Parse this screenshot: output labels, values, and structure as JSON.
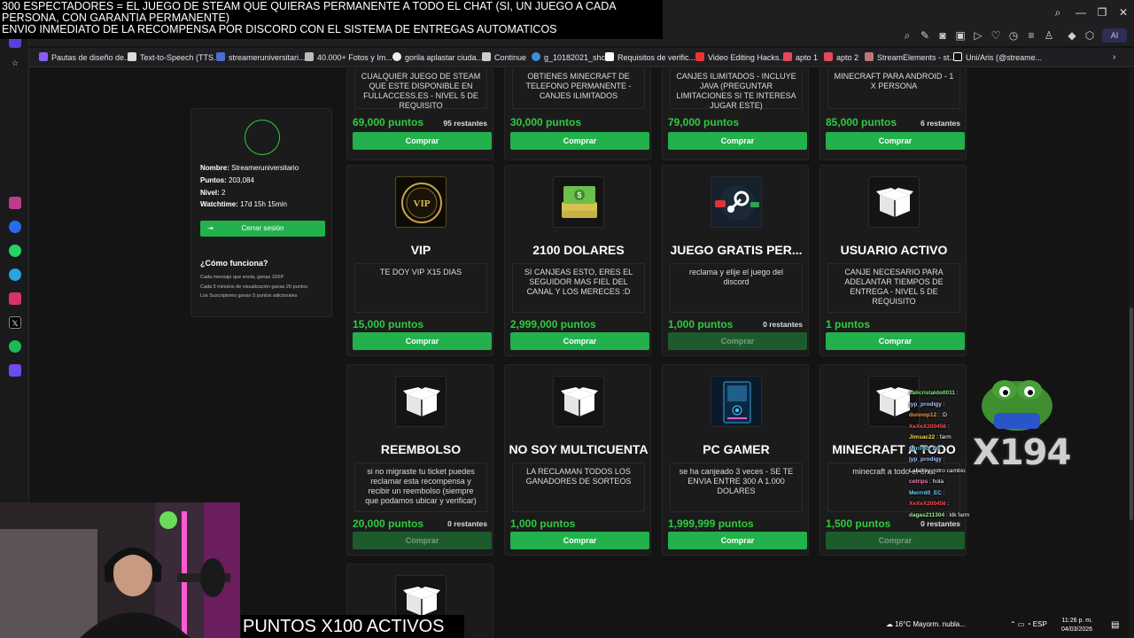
{
  "overlay": {
    "top_line1": "300 ESPECTADORES = EL JUEGO DE STEAM QUE QUIERAS PERMANENTE A TODO EL CHAT (SI, UN JUEGO A CADA PERSONA, CON GARANTIA PERMANENTE)",
    "top_line2": "ENVIO INMEDIATO DE LA RECOMPENSA POR DISCORD CON EL SISTEMA DE ENTREGAS AUTOMATICOS",
    "bottom": "PUNTOS X100 ACTIVOS"
  },
  "browser": {
    "ai_label": "AI",
    "bookmarks": [
      "Pautas de diseño de...",
      "Text-to-Speech (TTS...",
      "streameruniversitari...",
      "40.000+ Fotos y Im...",
      "gorila aplastar ciuda...",
      "Continue",
      "g_10182021_shcc",
      "Requisitos de verific...",
      "Video Editing Hacks...",
      "apto 1",
      "apto 2",
      "StreamElements - st...",
      "Uni/Aris (@streame..."
    ]
  },
  "profile": {
    "name_label": "Nombre:",
    "name_value": "Streameruniversitario",
    "points_label": "Puntos:",
    "points_value": "203,084",
    "level_label": "Nivel:",
    "level_value": "2",
    "watch_label": "Watchtime:",
    "watch_value": "17d 15h 15min",
    "logout": "Cerrar sesión",
    "how_title": "¿Cómo funciona?",
    "how_lines": [
      "Cada mensaje que envía, ganas 10XP",
      "Cada 5 minutos de visualización ganas 20 puntos",
      "Los Suscriptores ganan 5 puntos adicionales"
    ]
  },
  "top_cards": [
    {
      "desc": "CUALQUIER JUEGO DE STEAM QUE ESTE DISPONIBLE EN FULLACCESS.ES - NIVEL 5 DE REQUISITO",
      "price": "69,000 puntos",
      "stock": "95 restantes",
      "button": "Comprar"
    },
    {
      "desc": "OBTIENES MINECRAFT DE TELEFONO PERMANENTE - CANJES ILIMITADOS",
      "price": "30,000 puntos",
      "stock": "",
      "button": "Comprar"
    },
    {
      "desc": "CANJES ILIMITADOS - INCLUYE JAVA (PREGUNTAR LIMITACIONES SI TE INTERESA JUGAR ESTE)",
      "price": "79,000 puntos",
      "stock": "",
      "button": "Comprar"
    },
    {
      "desc": "MINECRAFT PARA ANDROID - 1 X PERSONA",
      "price": "85,000 puntos",
      "stock": "6 restantes",
      "button": "Comprar"
    }
  ],
  "cards": [
    {
      "title": "VIP",
      "desc": "TE DOY VIP X15 DIAS",
      "price": "15,000 puntos",
      "stock": "",
      "button": "Comprar",
      "disabled": false,
      "icon": "vip"
    },
    {
      "title": "2100 DOLARES",
      "desc": "SI CANJEAS ESTO, ERES EL SEGUIDOR MAS FIEL DEL CANAL Y LOS MERECES :D",
      "price": "2,999,000 puntos",
      "stock": "",
      "button": "Comprar",
      "disabled": false,
      "icon": "money"
    },
    {
      "title": "JUEGO GRATIS PER...",
      "desc": "reclama y elije el juego del discord",
      "price": "1,000 puntos",
      "stock": "0 restantes",
      "button": "Comprar",
      "disabled": true,
      "icon": "steam"
    },
    {
      "title": "USUARIO ACTIVO",
      "desc": "CANJE NECESARIO PARA ADELANTAR TIEMPOS DE ENTREGA - NIVEL 5 DE REQUISITO",
      "price": "1 puntos",
      "stock": "",
      "button": "Comprar",
      "disabled": false,
      "icon": "box"
    },
    {
      "title": "REEMBOLSO",
      "desc": "si no migraste tu ticket puedes reclamar esta recompensa y recibir un reembolso (siempre que podamos ubicar y verificar)",
      "price": "20,000 puntos",
      "stock": "0 restantes",
      "button": "Comprar",
      "disabled": true,
      "icon": "box"
    },
    {
      "title": "NO SOY MULTICUENTA",
      "desc": "LA RECLAMAN TODOS LOS GANADORES DE SORTEOS",
      "price": "1,000 puntos",
      "stock": "",
      "button": "Comprar",
      "disabled": false,
      "icon": "box"
    },
    {
      "title": "PC GAMER",
      "desc": "se ha canjeado 3 veces - SE TE ENVIA ENTRE 300 A 1.000 DOLARES",
      "price": "1,999,999 puntos",
      "stock": "",
      "button": "Comprar",
      "disabled": false,
      "icon": "pc"
    },
    {
      "title": "MINECRAFT A TODO",
      "desc": "minecraft a todo el chat",
      "price": "1,500 puntos",
      "stock": "0 restantes",
      "button": "Comprar",
      "disabled": true,
      "icon": "box"
    }
  ],
  "chat": [
    {
      "user": "calicristaldo0011",
      "msg": ""
    },
    {
      "user": "jyp_prodigy",
      "msg": ""
    },
    {
      "user": "dunnop12",
      "msg": ":D"
    },
    {
      "user": "XeXeX200456",
      "msg": ""
    },
    {
      "user": "Jimsac22",
      "msg": "farm"
    },
    {
      "user": "Mtrrrd0_EC",
      "msg": ""
    },
    {
      "user": "jyp_prodigy",
      "msg": ""
    },
    {
      "user": "Lalaitsy",
      "msg": "otro cambio"
    },
    {
      "user": "cetrips",
      "msg": "hola"
    },
    {
      "user": "Merrrd0_EC",
      "msg": ""
    },
    {
      "user": "XeXeX200456",
      "msg": ""
    },
    {
      "user": "dagas211304",
      "msg": "klk farm"
    }
  ],
  "emote_count": "X194",
  "taskbar": {
    "weather": "16°C  Mayorm. nubla...",
    "lang": "ESP",
    "time": "11:26 p. m.",
    "date": "04/03/2026"
  }
}
